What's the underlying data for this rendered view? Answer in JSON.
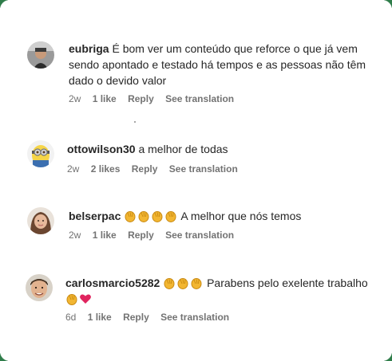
{
  "comments": [
    {
      "username": "eubriga",
      "text": "É bom ver um conteúdo que reforce o que já vem sendo apontado e testado há tempos e as pessoas não têm dado o devido valor",
      "time": "2w",
      "likes": "1 like",
      "reply": "Reply",
      "translate": "See translation"
    },
    {
      "username": "ottowilson30",
      "text": "a melhor de todas",
      "time": "2w",
      "likes": "2 likes",
      "reply": "Reply",
      "translate": "See translation"
    },
    {
      "username": "belserpac",
      "text": "A melhor que nós temos",
      "time": "2w",
      "likes": "1 like",
      "reply": "Reply",
      "translate": "See translation"
    },
    {
      "username": "carlosmarcio5282",
      "text": "Parabens pelo exelente trabalho",
      "time": "6d",
      "likes": "1 like",
      "reply": "Reply",
      "translate": "See translation"
    }
  ],
  "icons": {
    "clap": "clapping-hands-emoji",
    "heart": "red-heart-emoji"
  },
  "colors": {
    "text": "#262626",
    "meta": "#737373",
    "heart": "#e0245e",
    "clap": "#f2b632"
  }
}
